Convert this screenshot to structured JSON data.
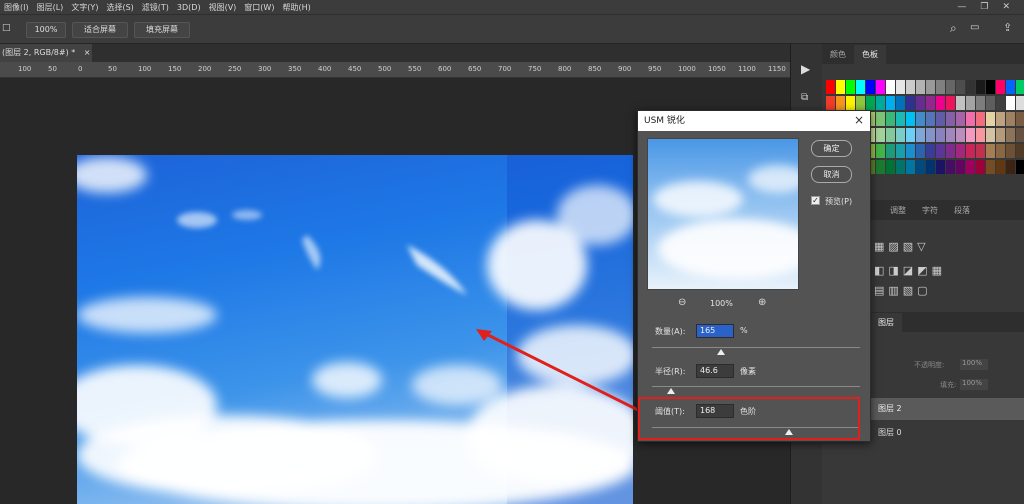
{
  "menubar": {
    "items": [
      "图像(I)",
      "图层(L)",
      "文字(Y)",
      "选择(S)",
      "滤镜(T)",
      "3D(D)",
      "视图(V)",
      "窗口(W)",
      "帮助(H)"
    ]
  },
  "optbar": {
    "zoom_value": "100%",
    "fit_screen_label": "适合屏幕",
    "fill_screen_label": "填充屏幕"
  },
  "doc_tab": {
    "label": "(图层 2, RGB/8#) *",
    "close": "×"
  },
  "ruler": {
    "ticks": [
      "100",
      "50",
      "0",
      "50",
      "100",
      "150",
      "200",
      "250",
      "300",
      "350",
      "400",
      "450",
      "500",
      "550",
      "600",
      "650",
      "700",
      "750",
      "800",
      "850",
      "900",
      "950",
      "1000",
      "1050",
      "1100",
      "1150"
    ]
  },
  "color_panel": {
    "tabs": [
      "颜色",
      "色板"
    ],
    "active_tab": "色板",
    "swatch_rows": [
      [
        "#ff0000",
        "#ffff00",
        "#00ff00",
        "#00ffff",
        "#0000ff",
        "#ff00ff",
        "#ffffff",
        "#e6e6e6",
        "#cccccc",
        "#b3b3b3",
        "#999999",
        "#808080",
        "#666666",
        "#4d4d4d",
        "#333333",
        "#1a1a1a",
        "#000000",
        "#ff0066",
        "#0066ff",
        "#00cc66"
      ],
      [
        "#f03c28",
        "#f7941d",
        "#fff200",
        "#8dc63f",
        "#00a651",
        "#00a99d",
        "#00aeef",
        "#0072bc",
        "#2e3192",
        "#662d91",
        "#92278f",
        "#ec008c",
        "#ed145b",
        "#c2c2c2",
        "#a3a3a3",
        "#7d7d7d",
        "#5e5e5e",
        "#404040",
        "#ffffff",
        "#dddddd"
      ],
      [
        "#f26c4f",
        "#f68e56",
        "#fbaf5d",
        "#fff568",
        "#acd372",
        "#7cc576",
        "#3bb878",
        "#1abbb4",
        "#00bff3",
        "#438ccb",
        "#5574b9",
        "#605ca8",
        "#8560a8",
        "#a763a8",
        "#f06ea9",
        "#f26d7d",
        "#e6d3a3",
        "#bfa380",
        "#9e8063",
        "#7a5c42"
      ],
      [
        "#f7977a",
        "#f9ad81",
        "#fdc68a",
        "#fff79a",
        "#c4df9b",
        "#a3d39c",
        "#82ca9d",
        "#7bcdc8",
        "#6ecff6",
        "#7ea7d8",
        "#8493ca",
        "#8882be",
        "#a187be",
        "#bc8dbf",
        "#f49ac2",
        "#f6989d",
        "#d4c3a2",
        "#b39b7c",
        "#8c7458",
        "#665140"
      ],
      [
        "#c6362d",
        "#d9722a",
        "#e8b12c",
        "#f2e235",
        "#92c045",
        "#43b34a",
        "#1b9b77",
        "#1a9ea8",
        "#1b8fce",
        "#2b63ae",
        "#3a3d98",
        "#5b3696",
        "#7e2d8d",
        "#a5267d",
        "#c8265a",
        "#c2304f",
        "#a67c52",
        "#8a6642",
        "#6e5034",
        "#523b26"
      ],
      [
        "#9e0b0f",
        "#a0410d",
        "#a36209",
        "#aba000",
        "#598527",
        "#1a7b30",
        "#007236",
        "#00746b",
        "#0076a3",
        "#004a80",
        "#003471",
        "#1b1464",
        "#440e62",
        "#630460",
        "#9e005d",
        "#9e0039",
        "#754c24",
        "#603913",
        "#3c2415",
        "#000000"
      ]
    ]
  },
  "adjust_panel": {
    "tabs": [
      "调整",
      "字符",
      "段落"
    ]
  },
  "layers_panel": {
    "tab": "图层",
    "opacity_label": "不透明度:",
    "opacity_value": "100%",
    "fill_label": "填充:",
    "fill_value": "100%",
    "layers": [
      "图层 2",
      "图层 0"
    ]
  },
  "dialog": {
    "title": "USM 锐化",
    "close": "×",
    "ok_label": "确定",
    "cancel_label": "取消",
    "preview_label": "预览(P)",
    "preview_checked": true,
    "zoom_value": "100%",
    "amount": {
      "label": "数量(A):",
      "value": "165",
      "unit": "%",
      "fraction": 0.33
    },
    "radius": {
      "label": "半径(R):",
      "value": "46.6",
      "unit": "像素",
      "fraction": 0.093
    },
    "threshold": {
      "label": "阈值(T):",
      "value": "168",
      "unit": "色阶",
      "fraction": 0.66
    }
  },
  "annotation": {
    "color": "#e0201b"
  }
}
